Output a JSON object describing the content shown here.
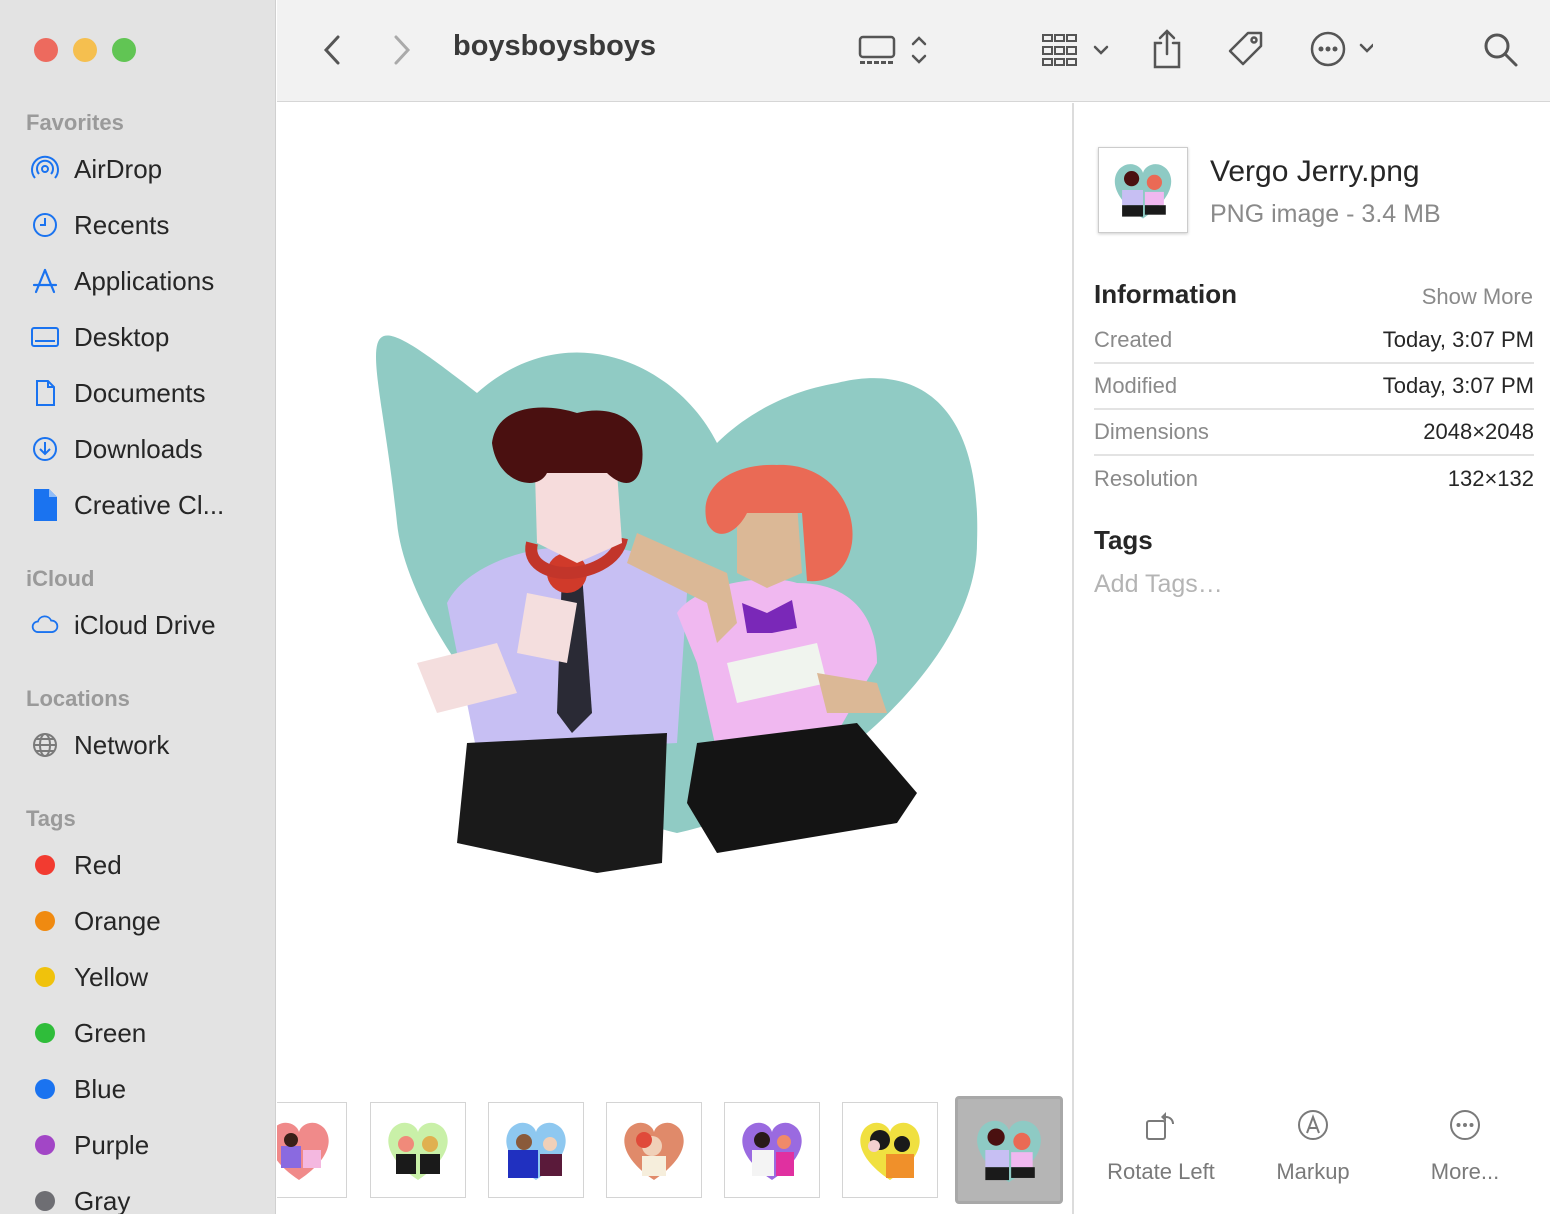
{
  "window": {
    "traffic_colors": {
      "close": "#ed6a5e",
      "minimize": "#f5bf4f",
      "zoom": "#61c554"
    }
  },
  "sidebar": {
    "favorites_title": "Favorites",
    "favorites": [
      {
        "label": "AirDrop",
        "icon": "airdrop-icon"
      },
      {
        "label": "Recents",
        "icon": "clock-icon"
      },
      {
        "label": "Applications",
        "icon": "applications-icon"
      },
      {
        "label": "Desktop",
        "icon": "desktop-icon"
      },
      {
        "label": "Documents",
        "icon": "document-icon"
      },
      {
        "label": "Downloads",
        "icon": "download-icon"
      },
      {
        "label": "Creative Cl...",
        "icon": "file-icon"
      }
    ],
    "icloud_title": "iCloud",
    "icloud": [
      {
        "label": "iCloud Drive",
        "icon": "cloud-icon"
      }
    ],
    "locations_title": "Locations",
    "locations": [
      {
        "label": "Network",
        "icon": "globe-icon"
      }
    ],
    "tags_title": "Tags",
    "tags": [
      {
        "label": "Red",
        "color": "#f23b30"
      },
      {
        "label": "Orange",
        "color": "#f08a10"
      },
      {
        "label": "Yellow",
        "color": "#f0c20c"
      },
      {
        "label": "Green",
        "color": "#2fbd3a"
      },
      {
        "label": "Blue",
        "color": "#1a73f0"
      },
      {
        "label": "Purple",
        "color": "#a246c6"
      },
      {
        "label": "Gray",
        "color": "#8e8e93"
      }
    ]
  },
  "toolbar": {
    "folder_title": "boysboysboys",
    "icons": [
      "back-icon",
      "forward-icon",
      "view-gallery-icon",
      "group-icon",
      "share-icon",
      "tag-icon",
      "more-icon",
      "search-icon"
    ]
  },
  "inspector": {
    "file_name": "Vergo Jerry.png",
    "file_kind": "PNG image - 3.4 MB",
    "information_title": "Information",
    "show_more": "Show More",
    "rows": [
      {
        "key": "Created",
        "value": "Today, 3:07 PM"
      },
      {
        "key": "Modified",
        "value": "Today, 3:07 PM"
      },
      {
        "key": "Dimensions",
        "value": "2048×2048"
      },
      {
        "key": "Resolution",
        "value": "132×132"
      }
    ],
    "tags_title": "Tags",
    "add_tags_placeholder": "Add Tags…",
    "actions": [
      {
        "label": "Rotate Left",
        "icon": "rotate-left-icon"
      },
      {
        "label": "Markup",
        "icon": "markup-icon"
      },
      {
        "label": "More...",
        "icon": "more-icon"
      }
    ]
  },
  "filmstrip": {
    "thumb_colors": [
      "#f08a8a",
      "#c9f0a8",
      "#8ec8f0",
      "#e08a6a",
      "#9a6ae0",
      "#f0e040",
      "#8ecac4"
    ],
    "selected_index": 6
  }
}
